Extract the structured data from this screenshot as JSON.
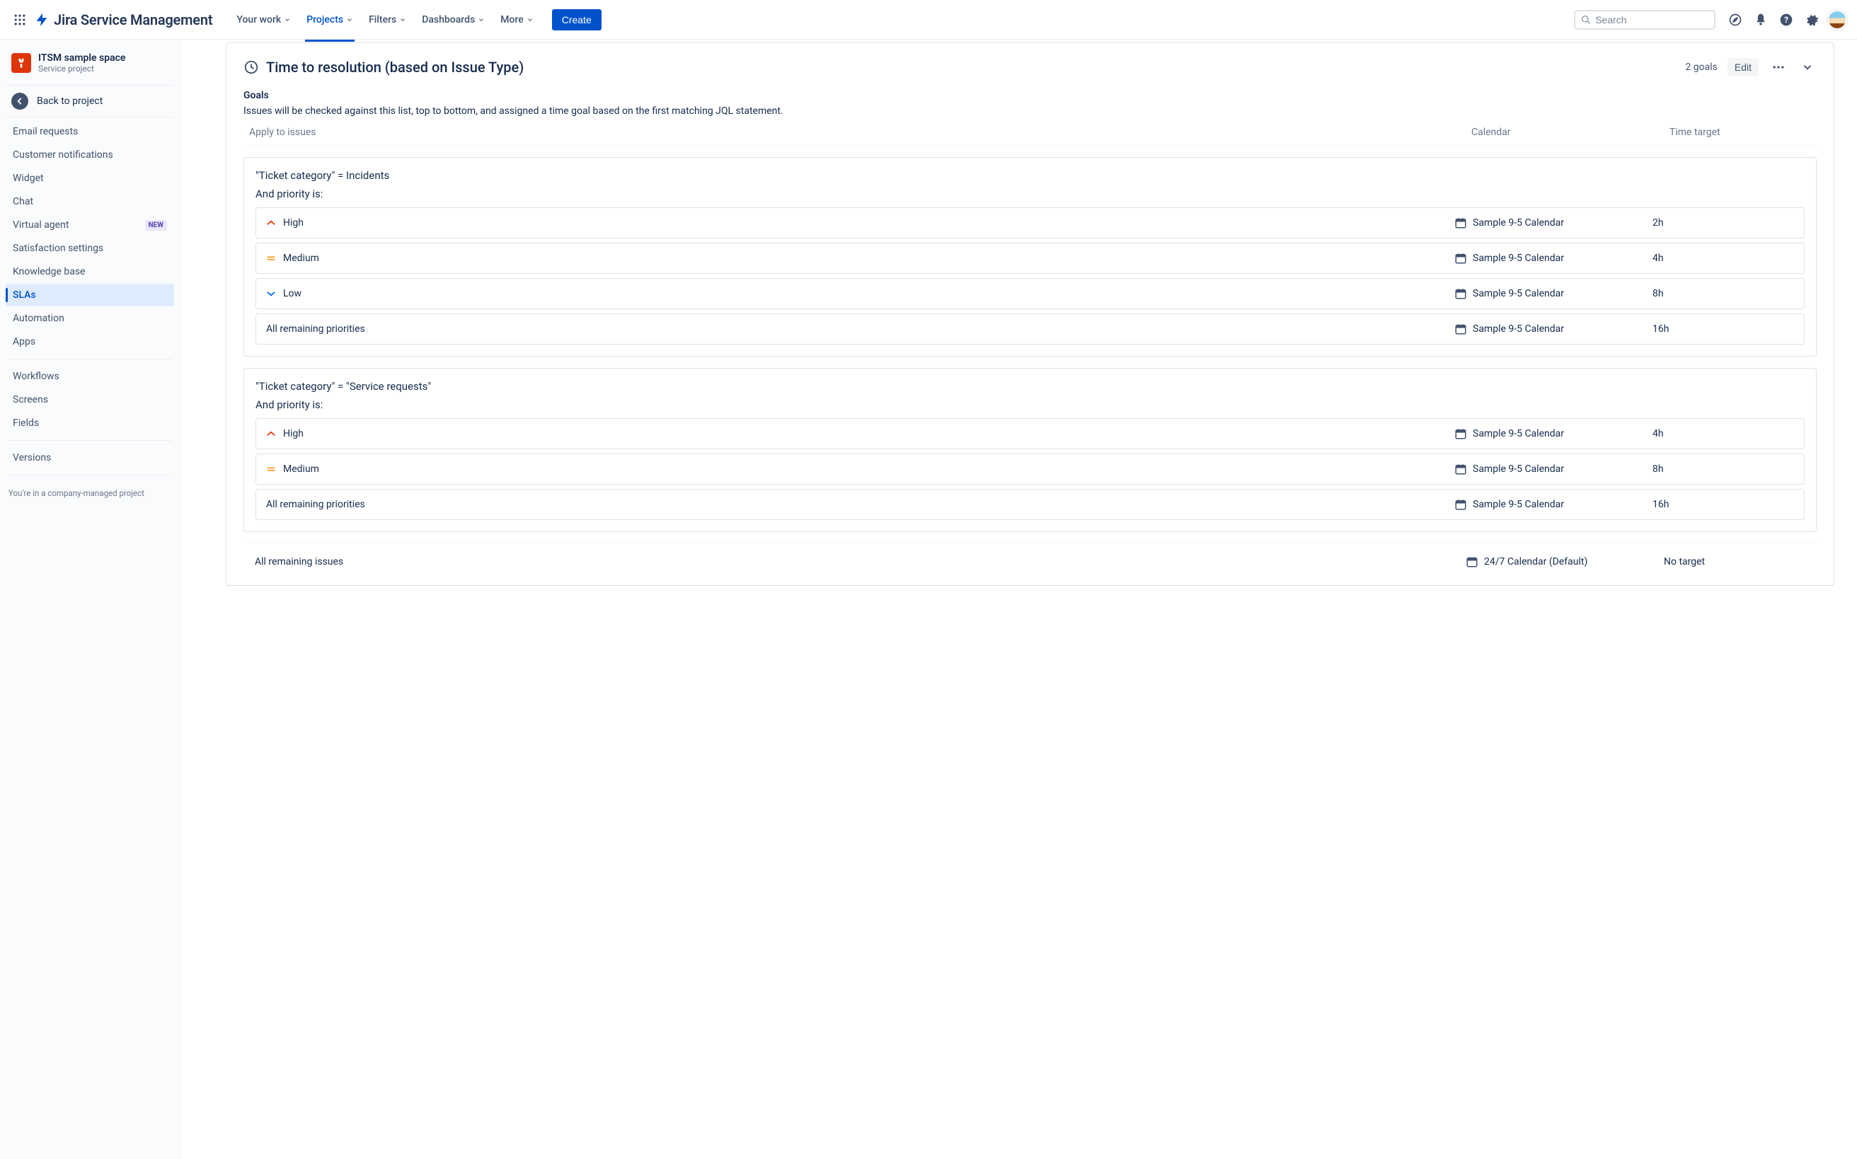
{
  "topnav": {
    "product_name": "Jira Service Management",
    "items": [
      "Your work",
      "Projects",
      "Filters",
      "Dashboards",
      "More"
    ],
    "active_index": 1,
    "create_label": "Create",
    "search_placeholder": "Search"
  },
  "sidebar": {
    "project_name": "ITSM sample space",
    "project_type": "Service project",
    "back_label": "Back to project",
    "items": [
      {
        "label": "Email requests"
      },
      {
        "label": "Customer notifications"
      },
      {
        "label": "Widget"
      },
      {
        "label": "Chat"
      },
      {
        "label": "Virtual agent",
        "badge": "NEW"
      },
      {
        "label": "Satisfaction settings"
      },
      {
        "label": "Knowledge base"
      },
      {
        "label": "SLAs",
        "selected": true
      },
      {
        "label": "Automation"
      },
      {
        "label": "Apps"
      }
    ],
    "group2": [
      {
        "label": "Workflows"
      },
      {
        "label": "Screens"
      },
      {
        "label": "Fields"
      }
    ],
    "group3": [
      {
        "label": "Versions"
      }
    ],
    "footer_note": "You're in a company-managed project"
  },
  "panel": {
    "title": "Time to resolution (based on Issue Type)",
    "goals_count": "2 goals",
    "edit_label": "Edit",
    "goals_heading": "Goals",
    "goals_desc": "Issues will be checked against this list, top to bottom, and assigned a time goal based on the first matching JQL statement.",
    "columns": {
      "apply": "Apply to issues",
      "calendar": "Calendar",
      "target": "Time target"
    },
    "groups": [
      {
        "jql": "\"Ticket category\" = Incidents",
        "priority_label": "And priority is:",
        "rules": [
          {
            "priority": "High",
            "priority_color": "#DE350B",
            "priority_type": "up",
            "calendar": "Sample 9-5 Calendar",
            "target": "2h"
          },
          {
            "priority": "Medium",
            "priority_color": "#FF991F",
            "priority_type": "eq",
            "calendar": "Sample 9-5 Calendar",
            "target": "4h"
          },
          {
            "priority": "Low",
            "priority_color": "#0065FF",
            "priority_type": "down",
            "calendar": "Sample 9-5 Calendar",
            "target": "8h"
          },
          {
            "priority": "All remaining priorities",
            "priority_type": "none",
            "calendar": "Sample 9-5 Calendar",
            "target": "16h"
          }
        ]
      },
      {
        "jql": "\"Ticket category\" = \"Service requests\"",
        "priority_label": "And priority is:",
        "rules": [
          {
            "priority": "High",
            "priority_color": "#DE350B",
            "priority_type": "up",
            "calendar": "Sample 9-5 Calendar",
            "target": "4h"
          },
          {
            "priority": "Medium",
            "priority_color": "#FF991F",
            "priority_type": "eq",
            "calendar": "Sample 9-5 Calendar",
            "target": "8h"
          },
          {
            "priority": "All remaining priorities",
            "priority_type": "none",
            "calendar": "Sample 9-5 Calendar",
            "target": "16h"
          }
        ]
      }
    ],
    "remaining": {
      "label": "All remaining issues",
      "calendar": "24/7 Calendar (Default)",
      "target": "No target"
    }
  }
}
